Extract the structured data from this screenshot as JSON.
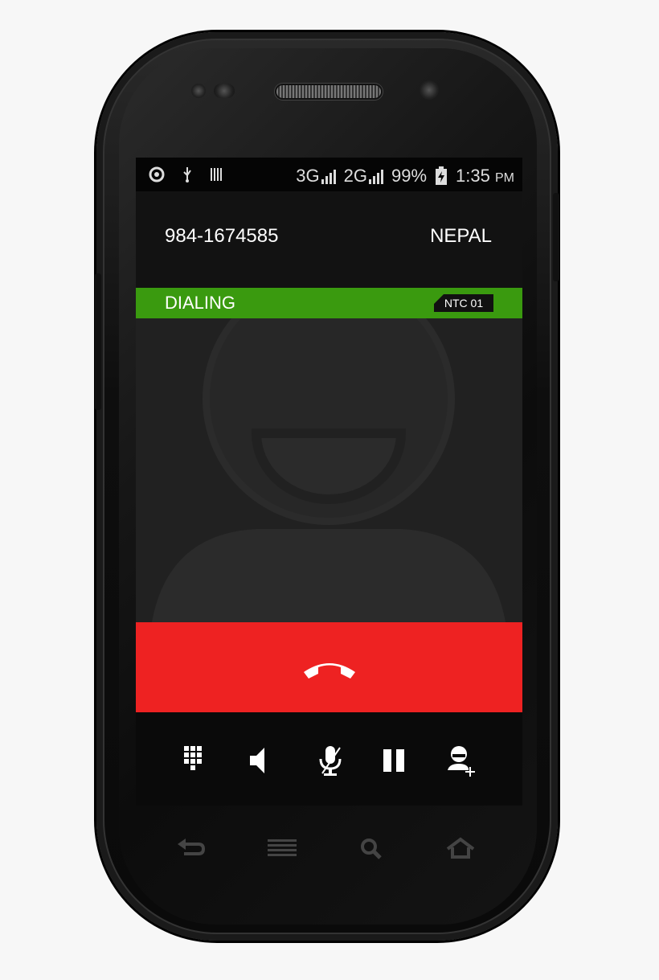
{
  "status_bar": {
    "network_1": "3G",
    "network_2": "2G",
    "battery": "99%",
    "time": "1:35",
    "ampm": "PM"
  },
  "call": {
    "number": "984-1674585",
    "country": "NEPAL",
    "status": "DIALING",
    "carrier": "NTC 01"
  },
  "icons": {
    "status_left": [
      "sync-icon",
      "usb-icon",
      "barcode-icon"
    ],
    "controls": [
      "dialpad-icon",
      "speaker-icon",
      "mute-icon",
      "hold-icon",
      "add-call-icon"
    ],
    "navbar": [
      "back-icon",
      "menu-icon",
      "search-icon",
      "home-icon"
    ]
  },
  "colors": {
    "dialing_bar": "#3a9a0f",
    "end_call": "#ee2222"
  }
}
